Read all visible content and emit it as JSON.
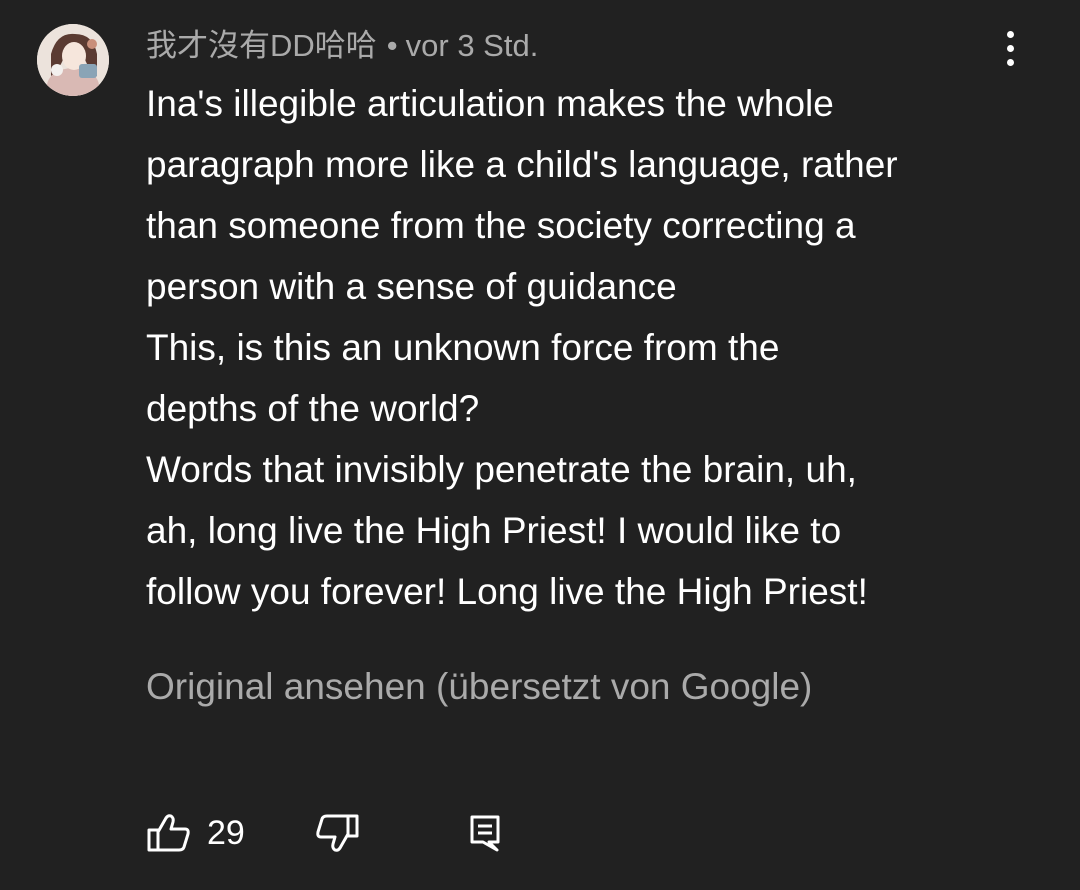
{
  "comment": {
    "author": "我才沒有DD哈哈",
    "separator": "•",
    "timestamp": "vor 3 Std.",
    "lines": [
      "Ina's illegible articulation makes the whole",
      "paragraph more like a child's language, rather",
      "than someone from the society correcting a",
      "person with a sense of guidance",
      "This, is this an unknown force from the",
      "depths of the world?",
      "Words that invisibly penetrate the brain, uh,",
      "ah, long live the High Priest! I would like to",
      "follow you forever! Long live the High Priest!"
    ],
    "translation_link": "Original ansehen (übersetzt von Google)"
  },
  "actions": {
    "like_count": "29"
  },
  "icons": {
    "menu": "more-vertical-icon",
    "like": "thumb-up-icon",
    "dislike": "thumb-down-icon",
    "reply": "reply-comment-icon"
  },
  "colors": {
    "background": "#212121",
    "text_primary": "#ffffff",
    "text_secondary": "#aaaaaa"
  }
}
